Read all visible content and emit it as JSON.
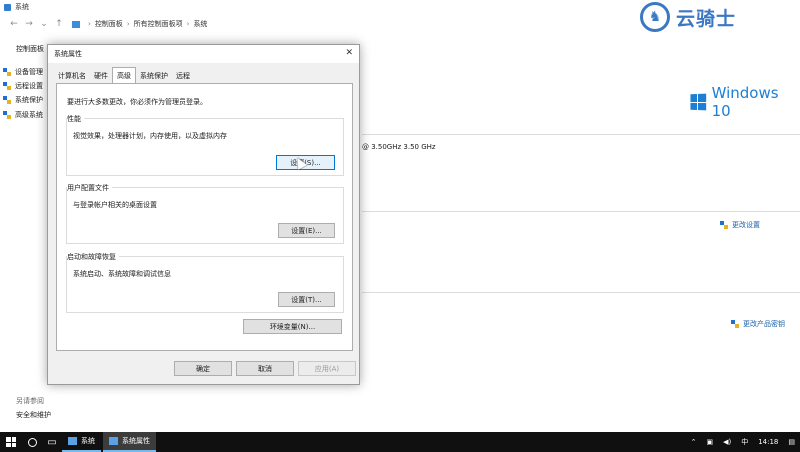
{
  "bg_window": {
    "title": "系统",
    "address": [
      "控制面板",
      "所有控制面板项",
      "系统"
    ],
    "home_link": "控制面板",
    "side_links": [
      "设备管理",
      "远程设置",
      "系统保护",
      "高级系统"
    ],
    "see_also": "另请参阅",
    "security": "安全和维护",
    "windows_logo": "Windows 10",
    "cpu_text": "@ 3.50GHz   3.50 GHz",
    "cpu_fragment": "",
    "change_settings": "更改设置",
    "change_product_key": "更改产品密钥"
  },
  "watermark": {
    "text": "云骑士"
  },
  "dialog": {
    "title": "系统属性",
    "close_glyph": "✕",
    "tabs": [
      "计算机名",
      "硬件",
      "高级",
      "系统保护",
      "远程"
    ],
    "active_tab_index": 2,
    "admin_note": "要进行大多数更改，你必须作为管理员登录。",
    "performance": {
      "label": "性能",
      "desc": "视觉效果，处理器计划，内存使用，以及虚拟内存",
      "button": "设置(S)..."
    },
    "user_profiles": {
      "label": "用户配置文件",
      "desc": "与登录帐户相关的桌面设置",
      "button": "设置(E)..."
    },
    "startup_recovery": {
      "label": "启动和故障恢复",
      "desc": "系统启动、系统故障和调试信息",
      "button": "设置(T)..."
    },
    "env_button": "环境变量(N)...",
    "ok_button": "确定",
    "cancel_button": "取消",
    "apply_button": "应用(A)"
  },
  "taskbar": {
    "apps": [
      "系统",
      "系统属性"
    ],
    "tray": {
      "language": "中",
      "time": "14:18"
    }
  }
}
